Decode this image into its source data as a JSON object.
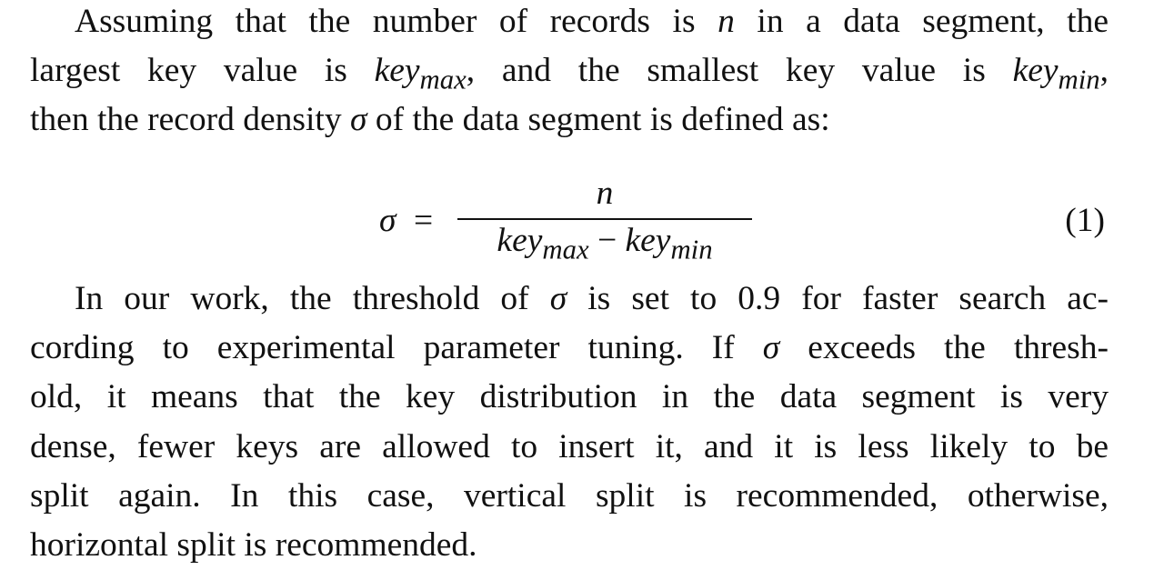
{
  "paragraph1": {
    "lines": [
      [
        "Assuming that the number of records is ",
        "n",
        " in a data segment, the"
      ],
      [
        "largest key value is ",
        "key",
        "max",
        ", and the smallest key value is ",
        "key",
        "min",
        ","
      ],
      [
        "then the record density ",
        "σ",
        " of the data segment is defined as:"
      ]
    ]
  },
  "equation": {
    "lhs": "σ",
    "equals": "=",
    "numerator": "n",
    "denominator": {
      "term1_base": "key",
      "term1_sub": "max",
      "operator": "−",
      "term2_base": "key",
      "term2_sub": "min"
    },
    "number": "(1)"
  },
  "paragraph2": {
    "line1": [
      "In our work, the threshold of ",
      "σ",
      " is set to 0.9 for faster search ac-"
    ],
    "line2": [
      "cording to experimental parameter tuning. If ",
      "σ",
      " exceeds the thresh-"
    ],
    "line3": "old, it means that the key distribution in the data segment is very",
    "line4": "dense, fewer keys are allowed to insert it, and it is less likely to be",
    "line5": "split again. In this case, vertical split is recommended, otherwise,",
    "line6": "horizontal split is recommended."
  }
}
